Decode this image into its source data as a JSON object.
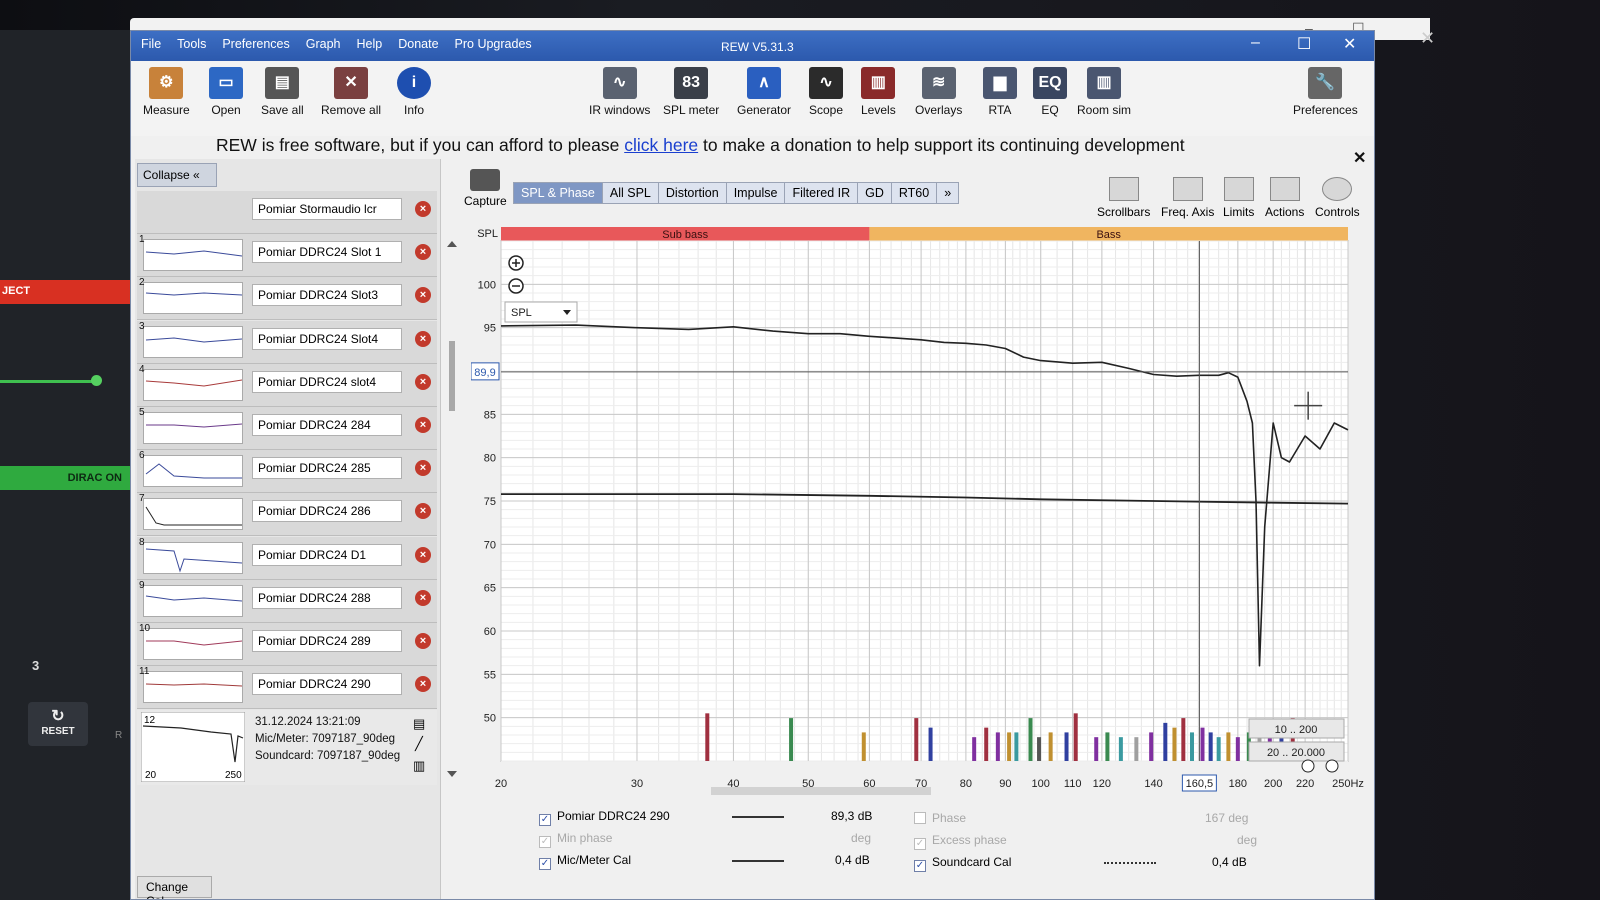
{
  "background": {
    "red_label": "JECT",
    "green_label": "DIRAC ON",
    "number": "3",
    "reset_label": "RESET",
    "r_label": "R"
  },
  "window": {
    "title": "REW V5.31.3",
    "menu": [
      "File",
      "Tools",
      "Preferences",
      "Graph",
      "Help",
      "Donate",
      "Pro Upgrades"
    ]
  },
  "toolbar": {
    "left": [
      {
        "label": "Measure",
        "icon": "measure-icon"
      },
      {
        "label": "Open",
        "icon": "folder-icon"
      },
      {
        "label": "Save all",
        "icon": "save-icon"
      },
      {
        "label": "Remove all",
        "icon": "remove-icon"
      },
      {
        "label": "Info",
        "icon": "info-icon"
      }
    ],
    "center": [
      {
        "label": "IR windows",
        "icon": "ir-icon"
      },
      {
        "label": "SPL meter",
        "icon": "spl-icon",
        "badge": "83"
      },
      {
        "label": "Generator",
        "icon": "generator-icon"
      },
      {
        "label": "Scope",
        "icon": "scope-icon"
      },
      {
        "label": "Levels",
        "icon": "levels-icon"
      },
      {
        "label": "Overlays",
        "icon": "overlays-icon"
      },
      {
        "label": "RTA",
        "icon": "rta-icon"
      },
      {
        "label": "EQ",
        "icon": "eq-icon"
      },
      {
        "label": "Room sim",
        "icon": "roomsim-icon"
      }
    ],
    "right": {
      "label": "Preferences",
      "icon": "wrench-icon"
    }
  },
  "donation": {
    "before": "REW is free software, but if you can afford to please ",
    "link": "click here",
    "after": " to make a donation to help support its continuing development"
  },
  "measurements": {
    "collapse_label": "Collapse",
    "items": [
      {
        "num": "",
        "name": "Pomiar Stormaudio lcr"
      },
      {
        "num": "1",
        "name": "Pomiar DDRC24 Slot 1"
      },
      {
        "num": "2",
        "name": "Pomiar DDRC24 Slot3"
      },
      {
        "num": "3",
        "name": "Pomiar DDRC24 Slot4"
      },
      {
        "num": "4",
        "name": "Pomiar DDRC24 slot4"
      },
      {
        "num": "5",
        "name": "Pomiar DDRC24 284"
      },
      {
        "num": "6",
        "name": "Pomiar DDRC24 285"
      },
      {
        "num": "7",
        "name": "Pomiar DDRC24 286"
      },
      {
        "num": "8",
        "name": "Pomiar DDRC24 D1"
      },
      {
        "num": "9",
        "name": "Pomiar DDRC24 288"
      },
      {
        "num": "10",
        "name": "Pomiar DDRC24 289"
      },
      {
        "num": "11",
        "name": "Pomiar DDRC24 290"
      }
    ],
    "current": {
      "num": "12",
      "date": "31.12.2024 13:21:09",
      "mic": "Mic/Meter: 7097187_90deg",
      "soundcard": "Soundcard: 7097187_90deg",
      "thumb_x_start": "20",
      "thumb_x_end": "250"
    },
    "change_cal_label": "Change Cal..."
  },
  "graph_toolbar": {
    "capture_label": "Capture",
    "tabs": [
      "SPL & Phase",
      "All SPL",
      "Distortion",
      "Impulse",
      "Filtered IR",
      "GD",
      "RT60",
      "»"
    ],
    "active_tab": "SPL & Phase",
    "right_tools": [
      "Scrollbars",
      "Freq. Axis",
      "Limits",
      "Actions",
      "Controls"
    ]
  },
  "chart_data": {
    "type": "line",
    "ylabel": "SPL",
    "y_ticks": [
      50,
      55,
      60,
      65,
      70,
      75,
      80,
      85,
      95,
      100
    ],
    "ylim": [
      45,
      105
    ],
    "x_ticks": [
      "20",
      "30",
      "40",
      "50",
      "60",
      "70",
      "80",
      "90",
      "100",
      "110",
      "120",
      "140",
      "160,5",
      "180",
      "200",
      "220",
      "250Hz"
    ],
    "xlim": [
      20,
      250
    ],
    "x_scale": "log",
    "cursor_y_label": "89,9",
    "cursor_x_label": "160,5",
    "cursor_freq": 160.5,
    "cursor_spl": 89.9,
    "bands": [
      {
        "name": "Sub bass",
        "from": 20,
        "to": 60,
        "color": "#e8585a"
      },
      {
        "name": "Bass",
        "from": 60,
        "to": 250,
        "color": "#f0b560"
      }
    ],
    "dropdown": "SPL",
    "range_boxes": [
      "10 .. 200",
      "20 .. 20.000"
    ],
    "series": [
      {
        "name": "Pomiar DDRC24 290",
        "color": "#222222",
        "x": [
          20,
          25,
          30,
          35,
          40,
          45,
          50,
          55,
          60,
          65,
          70,
          75,
          80,
          85,
          90,
          95,
          100,
          110,
          120,
          130,
          140,
          150,
          160,
          170,
          175,
          180,
          185,
          188,
          190,
          192,
          195,
          200,
          205,
          210,
          220,
          230,
          240,
          250
        ],
        "y": [
          95.2,
          95.3,
          95.0,
          94.8,
          95.1,
          94.6,
          94.3,
          94.3,
          94.0,
          93.8,
          93.6,
          93.3,
          93.2,
          93.0,
          92.6,
          91.6,
          91.2,
          90.9,
          91.0,
          90.3,
          89.6,
          89.4,
          89.5,
          89.5,
          89.8,
          89.3,
          86.5,
          84.0,
          75.0,
          56.0,
          72.0,
          84.0,
          80.0,
          79.5,
          82.5,
          81.0,
          84.0,
          83.2
        ]
      },
      {
        "name": "Mic/Meter Cal",
        "color": "#222222",
        "x": [
          20,
          40,
          60,
          80,
          100,
          140,
          200,
          250
        ],
        "y": [
          75.8,
          75.8,
          75.6,
          75.4,
          75.2,
          75.0,
          74.8,
          74.7
        ]
      }
    ],
    "rta_bars": [
      {
        "f": 37,
        "h": 10,
        "c": "#a03040"
      },
      {
        "f": 47.5,
        "h": 9,
        "c": "#3a8a50"
      },
      {
        "f": 59,
        "h": 6,
        "c": "#c09030"
      },
      {
        "f": 69,
        "h": 9,
        "c": "#a03040"
      },
      {
        "f": 72,
        "h": 7,
        "c": "#3040a0"
      },
      {
        "f": 82,
        "h": 5,
        "c": "#8030a0"
      },
      {
        "f": 85,
        "h": 7,
        "c": "#a03040"
      },
      {
        "f": 88,
        "h": 6,
        "c": "#8030a0"
      },
      {
        "f": 91,
        "h": 6,
        "c": "#c09030"
      },
      {
        "f": 93,
        "h": 6,
        "c": "#3a9aa0"
      },
      {
        "f": 97,
        "h": 9,
        "c": "#3a8a50"
      },
      {
        "f": 99.5,
        "h": 5,
        "c": "#555555"
      },
      {
        "f": 103,
        "h": 6,
        "c": "#c09030"
      },
      {
        "f": 108,
        "h": 6,
        "c": "#3040a0"
      },
      {
        "f": 111,
        "h": 10,
        "c": "#a03040"
      },
      {
        "f": 118,
        "h": 5,
        "c": "#8030a0"
      },
      {
        "f": 122,
        "h": 6,
        "c": "#3a8a50"
      },
      {
        "f": 127,
        "h": 5,
        "c": "#3a9aa0"
      },
      {
        "f": 133,
        "h": 5,
        "c": "#a0a0a0"
      },
      {
        "f": 139,
        "h": 6,
        "c": "#8030a0"
      },
      {
        "f": 145,
        "h": 8,
        "c": "#3040a0"
      },
      {
        "f": 149,
        "h": 7,
        "c": "#c09030"
      },
      {
        "f": 153,
        "h": 9,
        "c": "#a03040"
      },
      {
        "f": 157,
        "h": 6,
        "c": "#3a9aa0"
      },
      {
        "f": 162,
        "h": 7,
        "c": "#8030a0"
      },
      {
        "f": 166,
        "h": 6,
        "c": "#3040a0"
      },
      {
        "f": 170,
        "h": 5,
        "c": "#3a9aa0"
      },
      {
        "f": 175,
        "h": 6,
        "c": "#c09030"
      },
      {
        "f": 180,
        "h": 5,
        "c": "#8030a0"
      },
      {
        "f": 186,
        "h": 6,
        "c": "#3a8a50"
      },
      {
        "f": 192,
        "h": 5,
        "c": "#a0a0a0"
      },
      {
        "f": 198,
        "h": 6,
        "c": "#8030a0"
      },
      {
        "f": 205,
        "h": 5,
        "c": "#3040a0"
      },
      {
        "f": 212,
        "h": 9,
        "c": "#a03040"
      }
    ]
  },
  "legend": {
    "rows": [
      {
        "checked": true,
        "enabled": true,
        "name": "Pomiar DDRC24 290",
        "value": "89,3 dB"
      },
      {
        "checked": true,
        "enabled": false,
        "name": "Min phase",
        "value": "deg"
      },
      {
        "checked": true,
        "enabled": true,
        "name": "Mic/Meter Cal",
        "value": "0,4 dB"
      }
    ],
    "right_rows": [
      {
        "checked": false,
        "enabled": false,
        "name": "Phase",
        "value": "167 deg"
      },
      {
        "checked": true,
        "enabled": false,
        "name": "Excess phase",
        "value": "deg"
      },
      {
        "checked": true,
        "enabled": true,
        "name": "Soundcard Cal",
        "value": "0,4 dB"
      }
    ]
  }
}
